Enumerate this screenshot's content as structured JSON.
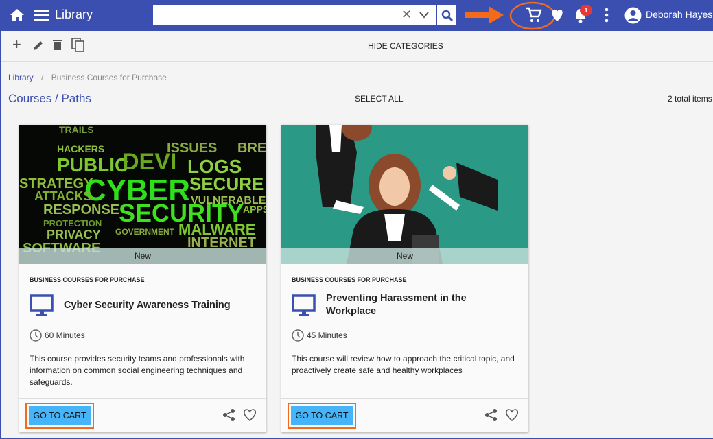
{
  "header": {
    "title": "Library",
    "search_placeholder": "",
    "notification_count": "1",
    "user_name": "Deborah Hayes",
    "accent": "#3b4fb0"
  },
  "toolbar": {
    "hide_categories": "HIDE CATEGORIES"
  },
  "breadcrumb": {
    "root": "Library",
    "separator": "/",
    "current": "Business Courses for Purchase"
  },
  "section": {
    "title": "Courses / Paths",
    "select_all": "SELECT ALL",
    "total": "2 total items"
  },
  "cards": [
    {
      "badge": "New",
      "category": "BUSINESS COURSES FOR PURCHASE",
      "title": "Cyber Security Awareness Training",
      "duration": "60 Minutes",
      "description": "This course provides security teams and professionals with information on common social engineering techniques and safeguards.",
      "button": "GO TO CART",
      "image_words": [
        "TRAILS",
        "HACKERS",
        "PUBLIC",
        "DEVI",
        "ISSUES",
        "LOGS",
        "BREACH",
        "STRATEGY",
        "CYBER",
        "SECURE",
        "ATTACKS",
        "RESPONSE",
        "VULNERABLE",
        "PROTECTION",
        "SECURITY",
        "APPS",
        "PRIVACY",
        "GOVERNMENT",
        "MALWARE",
        "SOFTWARE",
        "INTERNET"
      ]
    },
    {
      "badge": "New",
      "category": "BUSINESS COURSES FOR PURCHASE",
      "title": "Preventing Harassment in the Workplace",
      "duration": "45 Minutes",
      "description": "This course will review how to approach the critical topic,  and proactively create safe and healthy workplaces",
      "button": "GO TO CART"
    }
  ]
}
